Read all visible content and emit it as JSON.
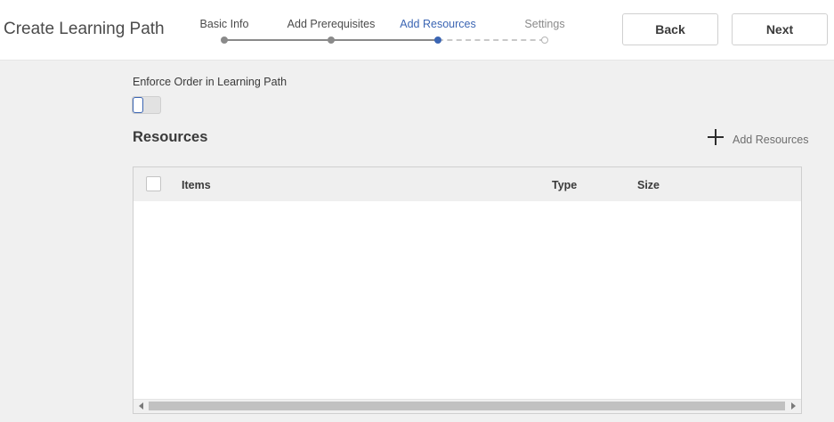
{
  "header": {
    "title": "Create Learning Path",
    "back_label": "Back",
    "next_label": "Next"
  },
  "stepper": {
    "steps": [
      {
        "label": "Basic Info",
        "state": "done"
      },
      {
        "label": "Add Prerequisites",
        "state": "done"
      },
      {
        "label": "Add Resources",
        "state": "active"
      },
      {
        "label": "Settings",
        "state": "future"
      }
    ],
    "colors": {
      "active": "#3b65b3",
      "done": "#8a8a8a",
      "future": "#b5b5b5"
    }
  },
  "enforce_order": {
    "label": "Enforce Order in Learning Path",
    "enabled": false
  },
  "resources": {
    "title": "Resources",
    "add_label": "Add Resources",
    "add_icon": "plus-icon",
    "table": {
      "columns": [
        "Items",
        "Type",
        "Size"
      ],
      "rows": []
    }
  }
}
